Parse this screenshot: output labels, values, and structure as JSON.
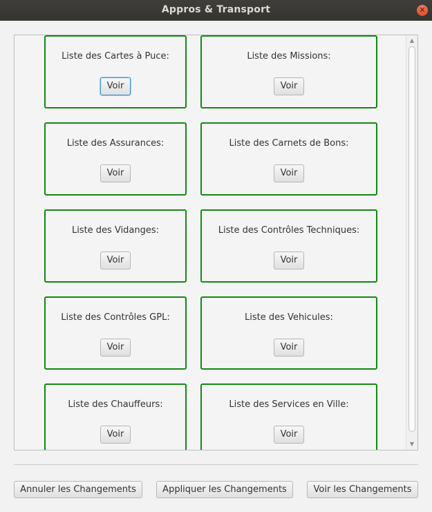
{
  "window": {
    "title": "Appros & Transport",
    "close_glyph": "✕"
  },
  "cards": [
    {
      "label": "Liste des Cartes à Puce:",
      "button": "Voir"
    },
    {
      "label": "Liste des Missions:",
      "button": "Voir"
    },
    {
      "label": "Liste des Assurances:",
      "button": "Voir"
    },
    {
      "label": "Liste des Carnets de Bons:",
      "button": "Voir"
    },
    {
      "label": "Liste des Vidanges:",
      "button": "Voir"
    },
    {
      "label": "Liste des Contrôles Techniques:",
      "button": "Voir"
    },
    {
      "label": "Liste des Contrôles GPL:",
      "button": "Voir"
    },
    {
      "label": "Liste des Vehicules:",
      "button": "Voir"
    },
    {
      "label": "Liste des Chauffeurs:",
      "button": "Voir"
    },
    {
      "label": "Liste des Services en Ville:",
      "button": "Voir"
    }
  ],
  "scrollbar": {
    "up_glyph": "▲",
    "down_glyph": "▼"
  },
  "footer": {
    "cancel_label": "Annuler les Changements",
    "apply_label": "Appliquer les Changements",
    "view_label": "Voir les Changements"
  },
  "colors": {
    "card_border": "#118811",
    "titlebar": "#3c3b37",
    "focus": "#3d94d6"
  }
}
